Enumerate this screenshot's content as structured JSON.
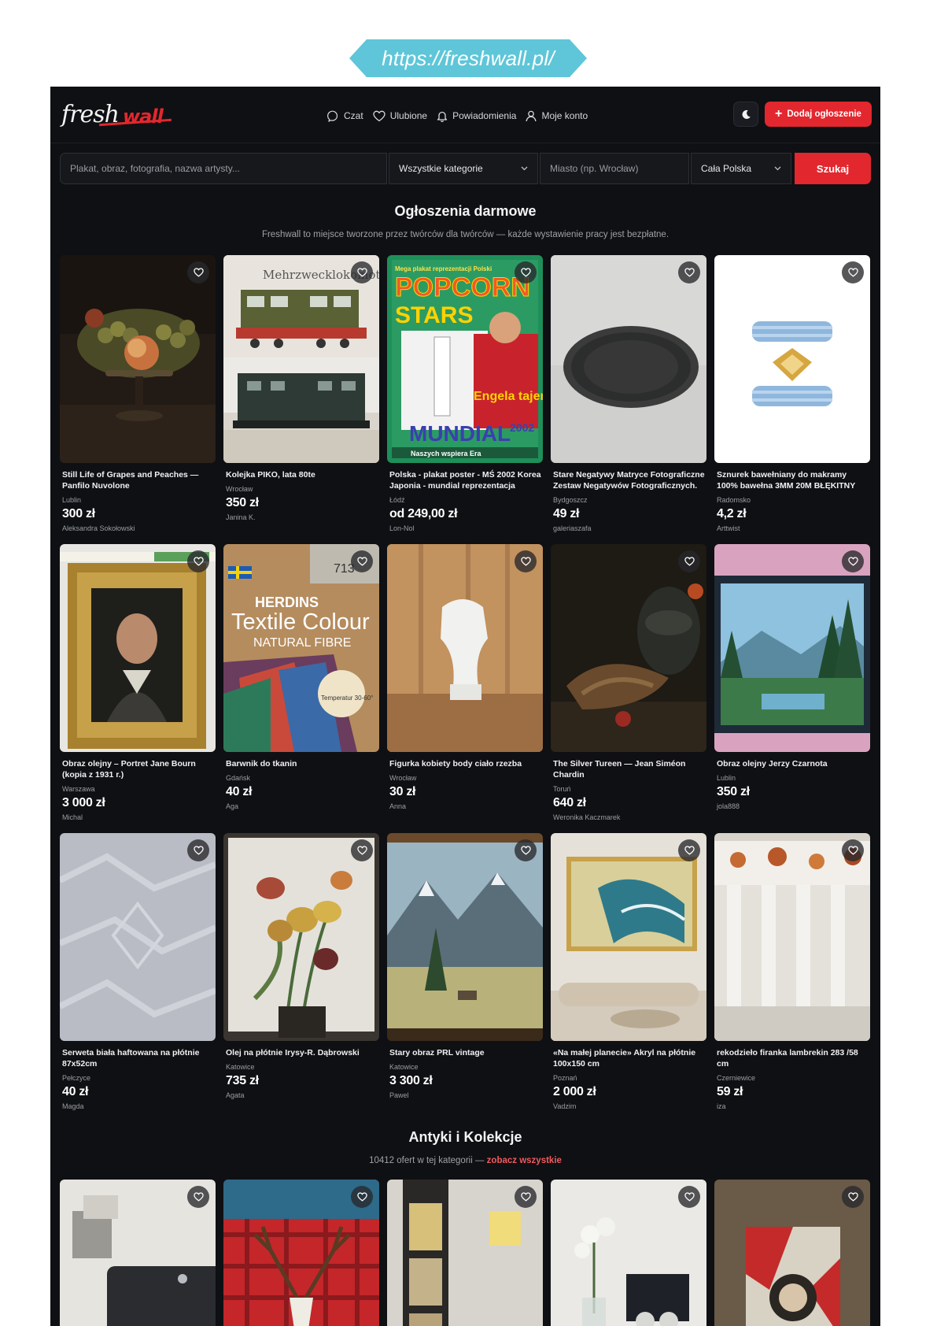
{
  "url": "https://freshwall.pl/",
  "colors": {
    "accent": "#e3272e",
    "background": "#0f1013",
    "url_banner": "#5ec6d8"
  },
  "header": {
    "logo": {
      "first": "fresh",
      "second": "wall"
    },
    "nav": [
      {
        "label": "Czat",
        "icon": "chat-icon"
      },
      {
        "label": "Ulubione",
        "icon": "heart-icon"
      },
      {
        "label": "Powiadomienia",
        "icon": "bell-icon"
      },
      {
        "label": "Moje konto",
        "icon": "user-icon"
      }
    ],
    "theme_icon": "moon-icon",
    "add_button": "Dodaj ogłoszenie"
  },
  "search": {
    "query_placeholder": "Plakat, obraz, fotografia, nazwa artysty...",
    "category": "Wszystkie kategorie",
    "city_placeholder": "Miasto (np. Wrocław)",
    "region": "Cała Polska",
    "button": "Szukaj"
  },
  "free_section": {
    "title": "Ogłoszenia darmowe",
    "subtitle": "Freshwall to miejsce tworzone przez twórców dla twórców — każde wystawienie pracy jest bezpłatne."
  },
  "listings": [
    {
      "title": "Still Life of Grapes and Peaches — Panfilo Nuvolone",
      "city": "Lublin",
      "price": "300 zł",
      "seller": "Aleksandra Sokołowski"
    },
    {
      "title": "Kolejka PIKO, lata 80te",
      "city": "Wrocław",
      "price": "350 zł",
      "seller": "Janina K."
    },
    {
      "title": "Polska - plakat poster - MŚ 2002 Korea Japonia - mundial reprezentacja",
      "city": "Łódź",
      "price": "od 249,00 zł",
      "seller": "Lon-Nol"
    },
    {
      "title": "Stare Negatywy Matryce Fotograficzne Zestaw Negatywów Fotograficznych.",
      "city": "Bydgoszcz",
      "price": "49 zł",
      "seller": "galeriaszafa"
    },
    {
      "title": "Sznurek bawełniany do makramy 100% bawełna 3MM 20M BŁĘKITNY",
      "city": "Radomsko",
      "price": "4,2 zł",
      "seller": "Arttwist"
    },
    {
      "title": "Obraz olejny – Portret Jane Bourn (kopia z 1931 r.)",
      "city": "Warszawa",
      "price": "3 000 zł",
      "seller": "Michal"
    },
    {
      "title": "Barwnik do tkanin",
      "city": "Gdańsk",
      "price": "40 zł",
      "seller": "Aga"
    },
    {
      "title": "Figurka kobiety body ciało rzezba",
      "city": "Wrocław",
      "price": "30 zł",
      "seller": "Anna"
    },
    {
      "title": "The Silver Tureen — Jean Siméon Chardin",
      "city": "Toruń",
      "price": "640 zł",
      "seller": "Weronika Kaczmarek"
    },
    {
      "title": "Obraz olejny Jerzy Czarnota",
      "city": "Lublin",
      "price": "350 zł",
      "seller": "jola888"
    },
    {
      "title": "Serweta biała haftowana na płótnie 87x52cm",
      "city": "Pełczyce",
      "price": "40 zł",
      "seller": "Magda"
    },
    {
      "title": "Olej na płótnie Irysy-R. Dąbrowski",
      "city": "Katowice",
      "price": "735 zł",
      "seller": "Agata"
    },
    {
      "title": "Stary obraz PRL vintage",
      "city": "Katowice",
      "price": "3 300 zł",
      "seller": "Pawel"
    },
    {
      "title": "«Na małej planecie» Akryl na płótnie 100x150 cm",
      "city": "Poznań",
      "price": "2 000 zł",
      "seller": "Vadzim"
    },
    {
      "title": "rekodzieło firanka lambrekin 283 /58 cm",
      "city": "Czerniewice",
      "price": "59 zł",
      "seller": "iza"
    }
  ],
  "antiques_section": {
    "title": "Antyki i Kolekcje",
    "subtitle": "10412 ofert w tej kategorii —",
    "link": "zobacz wszystkie"
  },
  "thumb_images": {
    "poster_text_1": "POPCORN",
    "poster_text_2": "STARS",
    "poster_text_3": "MUNDIAL",
    "poster_year": "2002",
    "poster_top": "Mega plakat reprezentacji Polski",
    "poster_bottom": "Naszych wspiera Era",
    "poster_side": "Engela tajemnic",
    "train_sign": "Mehrzwecklokomotive",
    "dye_brand": "HERDINS",
    "dye_line1": "Textile Colour",
    "dye_line2": "NATURAL FIBRE",
    "dye_number": "713",
    "dye_temp": "Temperatur 30-60°"
  }
}
